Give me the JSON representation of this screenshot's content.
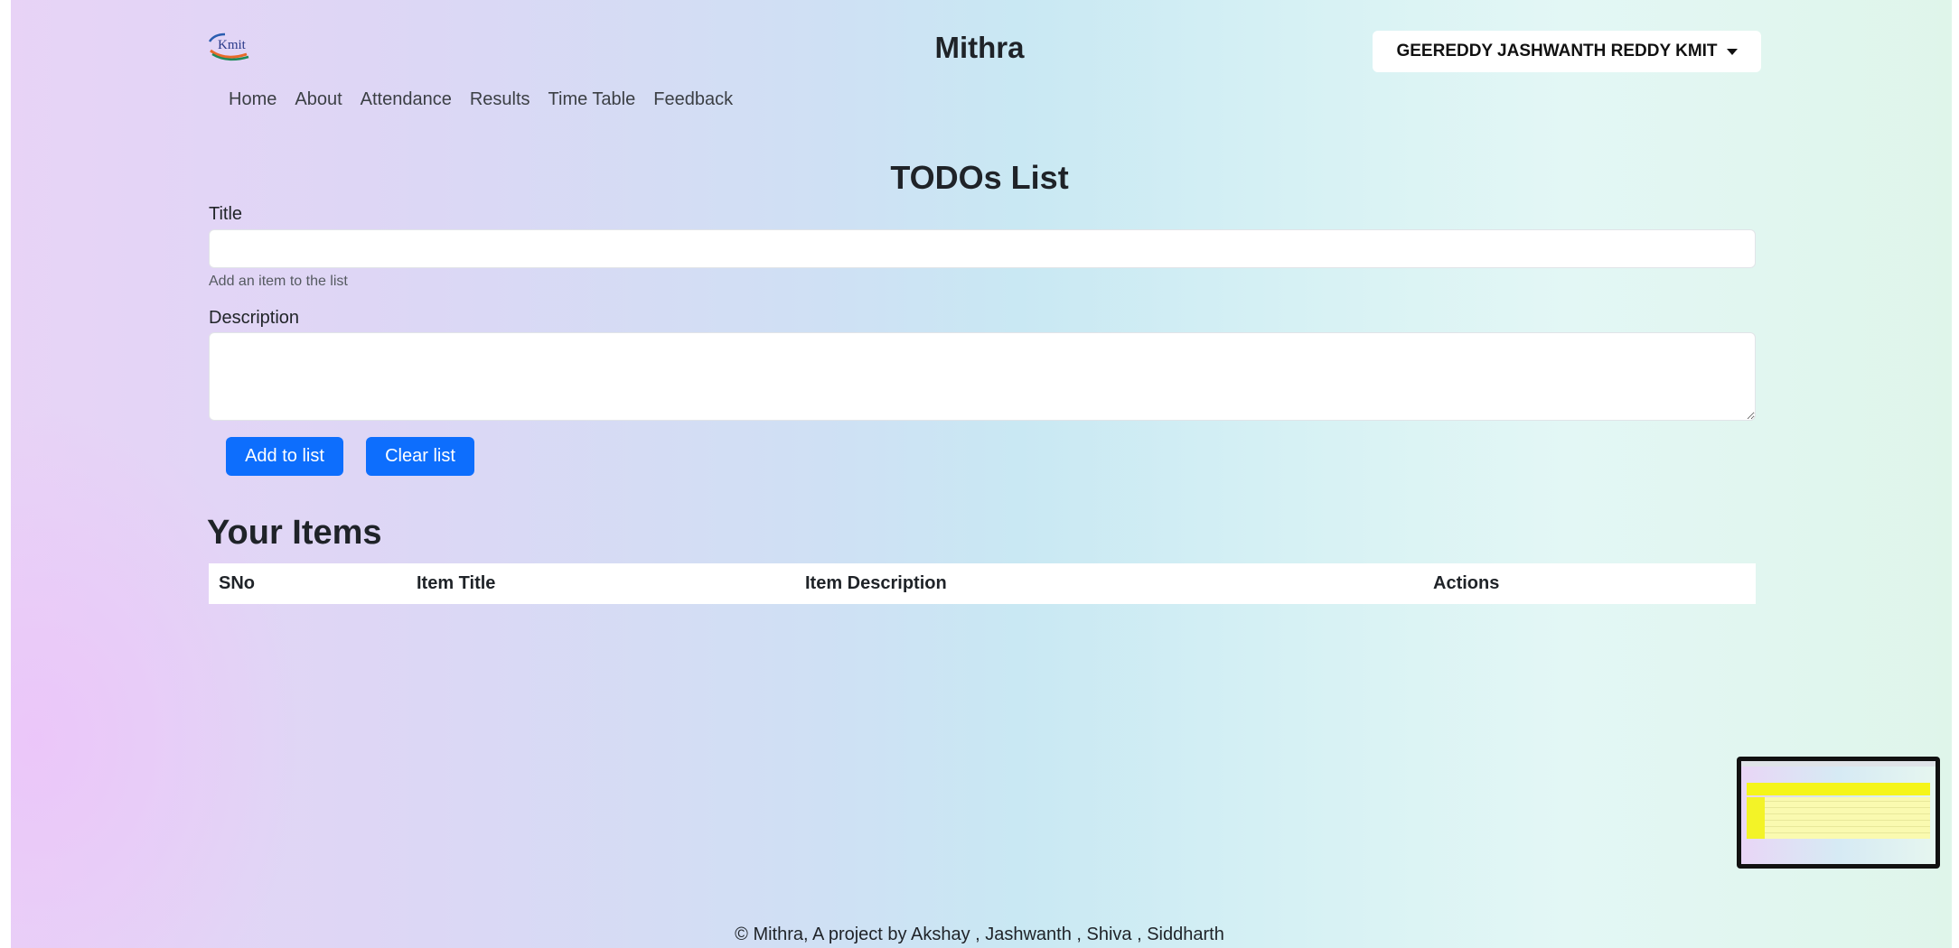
{
  "header": {
    "logo_text": "Kmit",
    "brand": "Mithra",
    "user_name": "GEEREDDY JASHWANTH REDDY KMIT"
  },
  "nav": {
    "items": [
      "Home",
      "About",
      "Attendance",
      "Results",
      "Time Table",
      "Feedback"
    ]
  },
  "main": {
    "page_title": "TODOs List",
    "title_label": "Title",
    "title_value": "",
    "title_help": "Add an item to the list",
    "description_label": "Description",
    "description_value": "",
    "add_button": "Add to list",
    "clear_button": "Clear list",
    "items_heading": "Your Items",
    "table_headers": [
      "SNo",
      "Item Title",
      "Item Description",
      "Actions"
    ]
  },
  "footer": {
    "text": "© Mithra, A project by Akshay , Jashwanth , Shiva , Siddharth"
  },
  "colors": {
    "primary_button": "#0d6efd",
    "surface": "#ffffff"
  },
  "icons": {
    "dropdown_caret": "caret-down-icon"
  }
}
